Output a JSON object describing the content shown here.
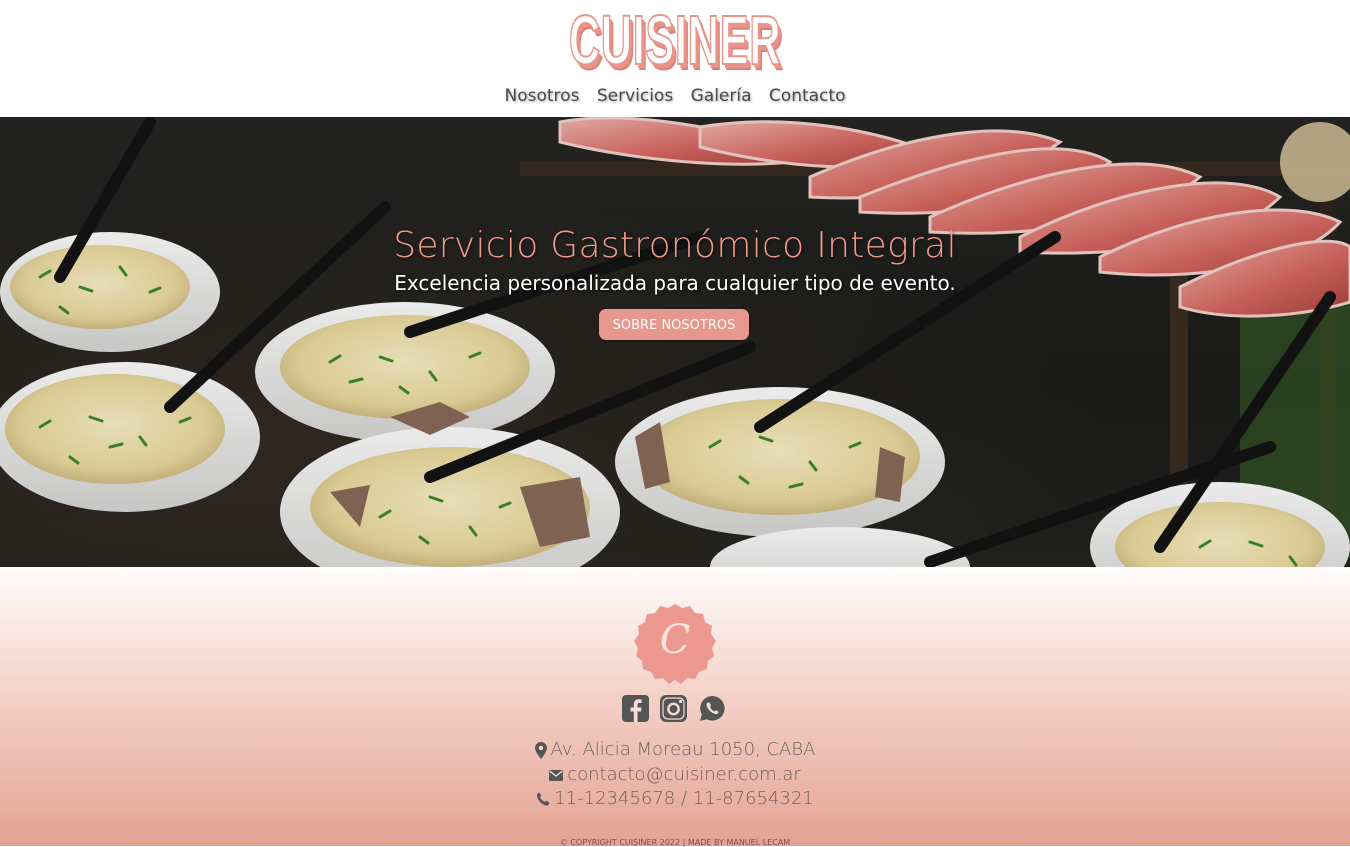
{
  "brand": {
    "logo_text": "CUISINER",
    "monogram": "C",
    "colors": {
      "accent": "#e8948a",
      "button": "#e7978b",
      "title": "#f29a8e",
      "text_dark": "#6d5f5c"
    }
  },
  "nav": {
    "items": [
      {
        "label": "Nosotros"
      },
      {
        "label": "Servicios"
      },
      {
        "label": "Galería"
      },
      {
        "label": "Contacto"
      }
    ]
  },
  "hero": {
    "title": "Servicio Gastronómico Integral",
    "subtitle": "Excelencia personalizada para cualquier tipo de evento.",
    "button_label": "SOBRE NOSOTROS",
    "background_icon": "catering-food-photo"
  },
  "footer": {
    "social_icons": [
      "facebook-icon",
      "instagram-icon",
      "whatsapp-icon"
    ],
    "address": "Av. Alicia Moreau 1050, CABA",
    "email": "contacto@cuisiner.com.ar",
    "phones": "11-12345678 / 11-87654321",
    "copyright": "© COPYRIGHT CUISINER 2022 | MADE BY MANUEL LECAM"
  }
}
